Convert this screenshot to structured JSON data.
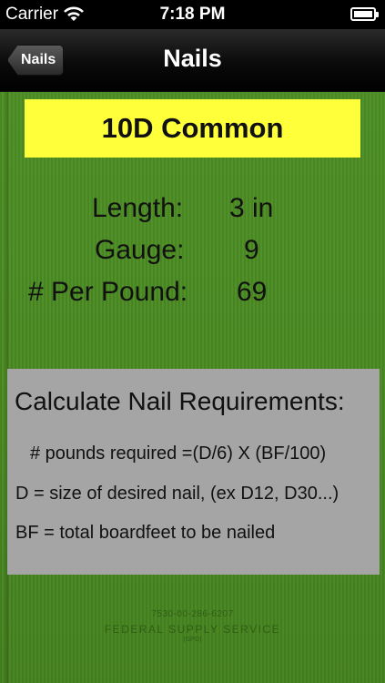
{
  "status_bar": {
    "carrier": "Carrier",
    "time": "7:18 PM"
  },
  "nav": {
    "back_label": "Nails",
    "title": "Nails"
  },
  "nail": {
    "name": "10D Common",
    "length_label": "Length:",
    "length_value": "3 in",
    "gauge_label": "Gauge:",
    "gauge_value": "9",
    "per_pound_label": "# Per Pound:",
    "per_pound_value": "69"
  },
  "calculator": {
    "title": "Calculate Nail Requirements:",
    "line1": "# pounds required =(D/6) X (BF/100)",
    "line2": "D = size of desired nail, (ex D12, D30...)",
    "line3": "BF = total boardfeet to be nailed"
  },
  "cover": {
    "stock_number": "7530-00-286-6207",
    "agency": "FEDERAL SUPPLY SERVICE",
    "gpo": "(GPO)"
  },
  "colors": {
    "cover_green": "#4a8a22",
    "title_yellow": "#ffff3a",
    "calc_gray": "#a5a5a5"
  }
}
